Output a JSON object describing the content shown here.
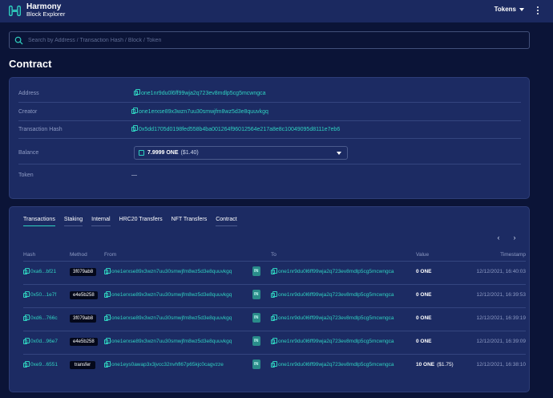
{
  "header": {
    "logo_line1": "Harmony",
    "logo_line2": "Block Explorer",
    "tokens_label": "Tokens"
  },
  "search": {
    "placeholder": "Search by Address / Transaction Hash / Block / Token"
  },
  "page_title": "Contract",
  "info": {
    "address_label": "Address",
    "address_value": "one1nr9du0l6ff99wja2q723ev8mdlp5cg5mcwngca",
    "creator_label": "Creator",
    "creator_value": "one1erxse89x3wzn7uu30smwjfm8wz5d3e8quuvkgq",
    "txhash_label": "Transaction Hash",
    "txhash_value": "0x5dd1705d0198fed558b4ba001264f96012564e217a8e8c10049095d8111e7eb6",
    "balance_label": "Balance",
    "balance_amount": "7.9999 ONE",
    "balance_usd": "($1.40)",
    "token_label": "Token",
    "token_value": "—"
  },
  "tabs": [
    "Transactions",
    "Staking",
    "Internal",
    "HRC20 Transfers",
    "NFT Transfers",
    "Contract"
  ],
  "pager": {
    "prev": "‹",
    "next": "›"
  },
  "table": {
    "headers": {
      "hash": "Hash",
      "method": "Method",
      "from": "From",
      "to": "To",
      "value": "Value",
      "timestamp": "Timestamp"
    },
    "rows": [
      {
        "hash": "0xa6...bf21",
        "method": "3f079ab8",
        "from": "one1erxse89x3wzn7uu30smwjfm8wz5d3e8quuvkgq",
        "direction": "IN",
        "to": "one1nr9du0l6ff99wja2q723ev8mdlp5cg5mcwngca",
        "value": "0 ONE",
        "value_usd": "",
        "timestamp": "12/12/2021, 16:40:03"
      },
      {
        "hash": "0x50...1e7f",
        "method": "e4e5b258",
        "from": "one1erxse89x3wzn7uu30smwjfm8wz5d3e8quuvkgq",
        "direction": "IN",
        "to": "one1nr9du0l6ff99wja2q723ev8mdlp5cg5mcwngca",
        "value": "0 ONE",
        "value_usd": "",
        "timestamp": "12/12/2021, 16:39:53"
      },
      {
        "hash": "0xd6...766c",
        "method": "3f079ab8",
        "from": "one1erxse89x3wzn7uu30smwjfm8wz5d3e8quuvkgq",
        "direction": "IN",
        "to": "one1nr9du0l6ff99wja2q723ev8mdlp5cg5mcwngca",
        "value": "0 ONE",
        "value_usd": "",
        "timestamp": "12/12/2021, 16:39:19"
      },
      {
        "hash": "0x0d...96e7",
        "method": "e4e5b258",
        "from": "one1erxse89x3wzn7uu30smwjfm8wz5d3e8quuvkgq",
        "direction": "IN",
        "to": "one1nr9du0l6ff99wja2q723ev8mdlp5cg5mcwngca",
        "value": "0 ONE",
        "value_usd": "",
        "timestamp": "12/12/2021, 16:39:09"
      },
      {
        "hash": "0xe9...6551",
        "method": "transfer",
        "from": "one1eys0awap3x3jvcc32nvhfl67p65kjc0cagvzze",
        "direction": "IN",
        "to": "one1nr9du0l6ff99wja2q723ev8mdlp5cg5mcwngca",
        "value": "10 ONE",
        "value_usd": "($1.75)",
        "timestamp": "12/12/2021, 16:38:10"
      }
    ]
  },
  "colors": {
    "background": "#0b1437",
    "card": "#1c2b63",
    "accent": "#2fd1c0",
    "header": "#1b2960"
  },
  "icons": {
    "logo": "harmony-logo-icon",
    "search": "search-icon",
    "menu": "more-vertical-icon",
    "copy": "copy-icon",
    "balance": "token-icon",
    "dropdown": "chevron-down-icon"
  }
}
